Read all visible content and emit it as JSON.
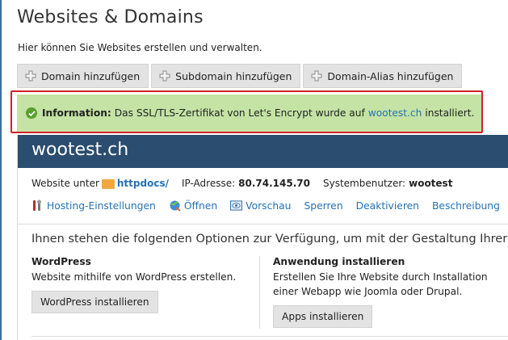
{
  "page": {
    "title": "Websites & Domains",
    "description": "Hier können Sie Websites erstellen und verwalten."
  },
  "toolbar": {
    "add_domain": "Domain hinzufügen",
    "add_subdomain": "Subdomain hinzufügen",
    "add_alias": "Domain-Alias hinzufügen"
  },
  "info": {
    "label": "Information:",
    "text_before": "Das SSL/TLS-Zertifikat von Let's Encrypt wurde auf",
    "link": "wootest.ch",
    "text_after": "installiert.",
    "highlight_color": "#d2202b"
  },
  "site": {
    "name": "wootest.ch",
    "website_under_label": "Website unter",
    "folder": "httpdocs/",
    "ip_label": "IP-Adresse:",
    "ip": "80.74.145.70",
    "user_label": "Systembenutzer:",
    "user": "wootest",
    "actions": [
      {
        "label": "Hosting-Einstellungen",
        "icon": "wrench-icon"
      },
      {
        "label": "Öffnen",
        "icon": "globe-icon"
      },
      {
        "label": "Vorschau",
        "icon": "preview-icon"
      },
      {
        "label": "Sperren",
        "icon": ""
      },
      {
        "label": "Deaktivieren",
        "icon": ""
      },
      {
        "label": "Beschreibung",
        "icon": ""
      }
    ],
    "options_text": "Ihnen stehen die folgenden Optionen zur Verfügung, um mit der Gestaltung Ihrer We",
    "wordpress": {
      "title": "WordPress",
      "text": "Website mithilfe von WordPress erstellen.",
      "button": "WordPress installieren"
    },
    "apps": {
      "title": "Anwendung installieren",
      "text_line1": "Erstellen Sie Ihre Website durch Installation",
      "text_line2": "einer Webapp wie Joomla oder Drupal.",
      "button": "Apps installieren"
    }
  },
  "colors": {
    "header_bg": "#2b4d6f",
    "info_bg": "#c4e3a4",
    "link": "#2572b4"
  }
}
